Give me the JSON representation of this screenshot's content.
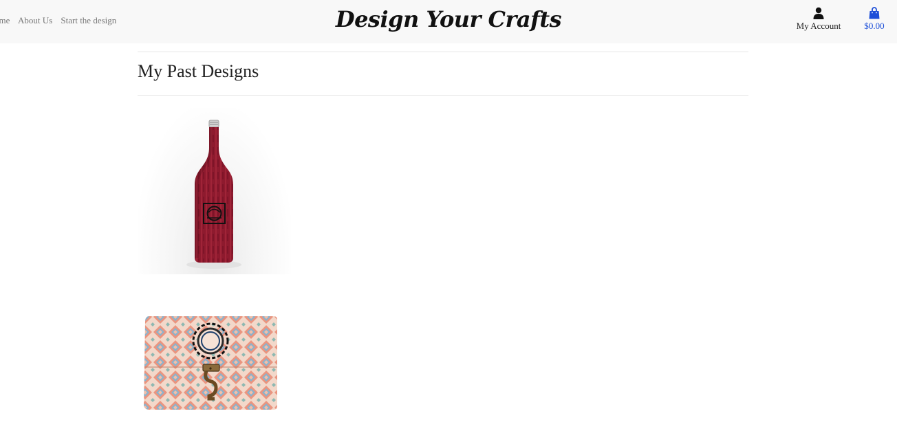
{
  "nav": {
    "items": [
      "ome",
      "About Us",
      "Start the design"
    ]
  },
  "brand": {
    "logo_text": "Design Your Crafts"
  },
  "account": {
    "label": "My Account",
    "icon": "user-icon"
  },
  "cart": {
    "total": "$0.00",
    "icon": "shopping-bag-icon"
  },
  "colors": {
    "accent": "#1d4fd8",
    "bottle": "#8e1a2e",
    "header_bg": "#f8f8f8"
  },
  "page": {
    "title": "My Past Designs"
  },
  "designs": [
    {
      "item": "red-wine-bottle-design"
    },
    {
      "item": "patterned-wooden-box-design"
    }
  ]
}
